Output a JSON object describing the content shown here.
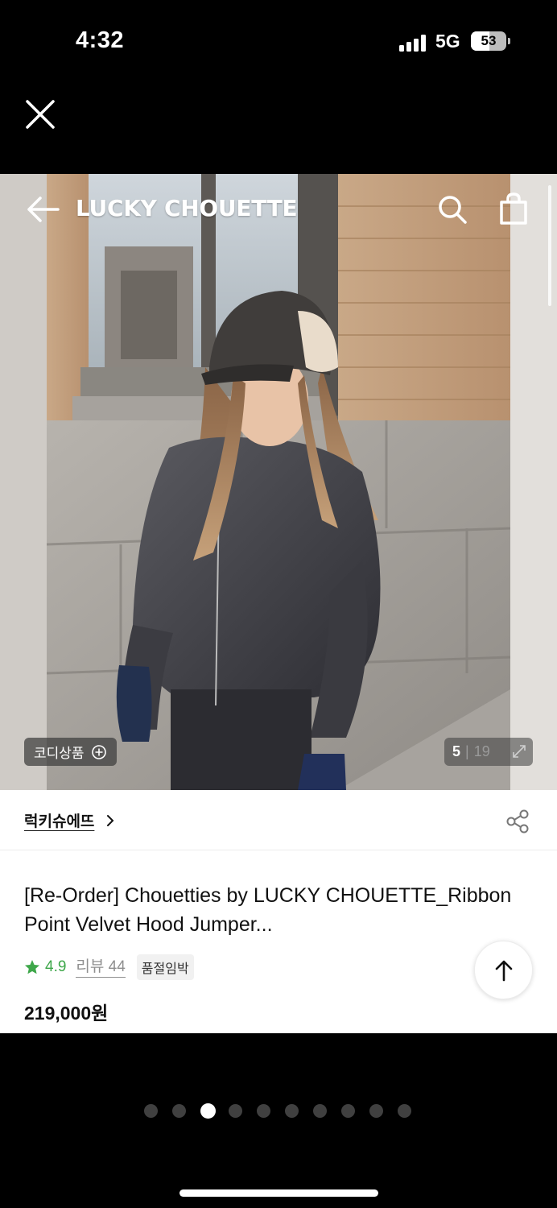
{
  "status_bar": {
    "time": "4:32",
    "network": "5G",
    "battery": "53",
    "battery_level": 0.53
  },
  "viewer": {
    "close_icon": "close-icon"
  },
  "header": {
    "brand_title": "LUCKY CHOUETTE",
    "back_icon": "arrow-left-icon",
    "search_icon": "search-icon",
    "bag_icon": "shopping-bag-icon"
  },
  "image": {
    "coordi_label": "코디상품",
    "current_index": "5",
    "total_count": "19",
    "expand_icon": "expand-icon"
  },
  "product": {
    "brand_link": "럭키슈에뜨",
    "title": "[Re-Order] Chouetties by LUCKY CHOUETTE_Ribbon Point Velvet Hood Jumper...",
    "rating": "4.9",
    "review_label": "리뷰 44",
    "badge": "품절임박",
    "price": "219,000원"
  },
  "colors": {
    "rating_green": "#3ea74a"
  },
  "pager": {
    "count": 10,
    "active_index": 2
  }
}
